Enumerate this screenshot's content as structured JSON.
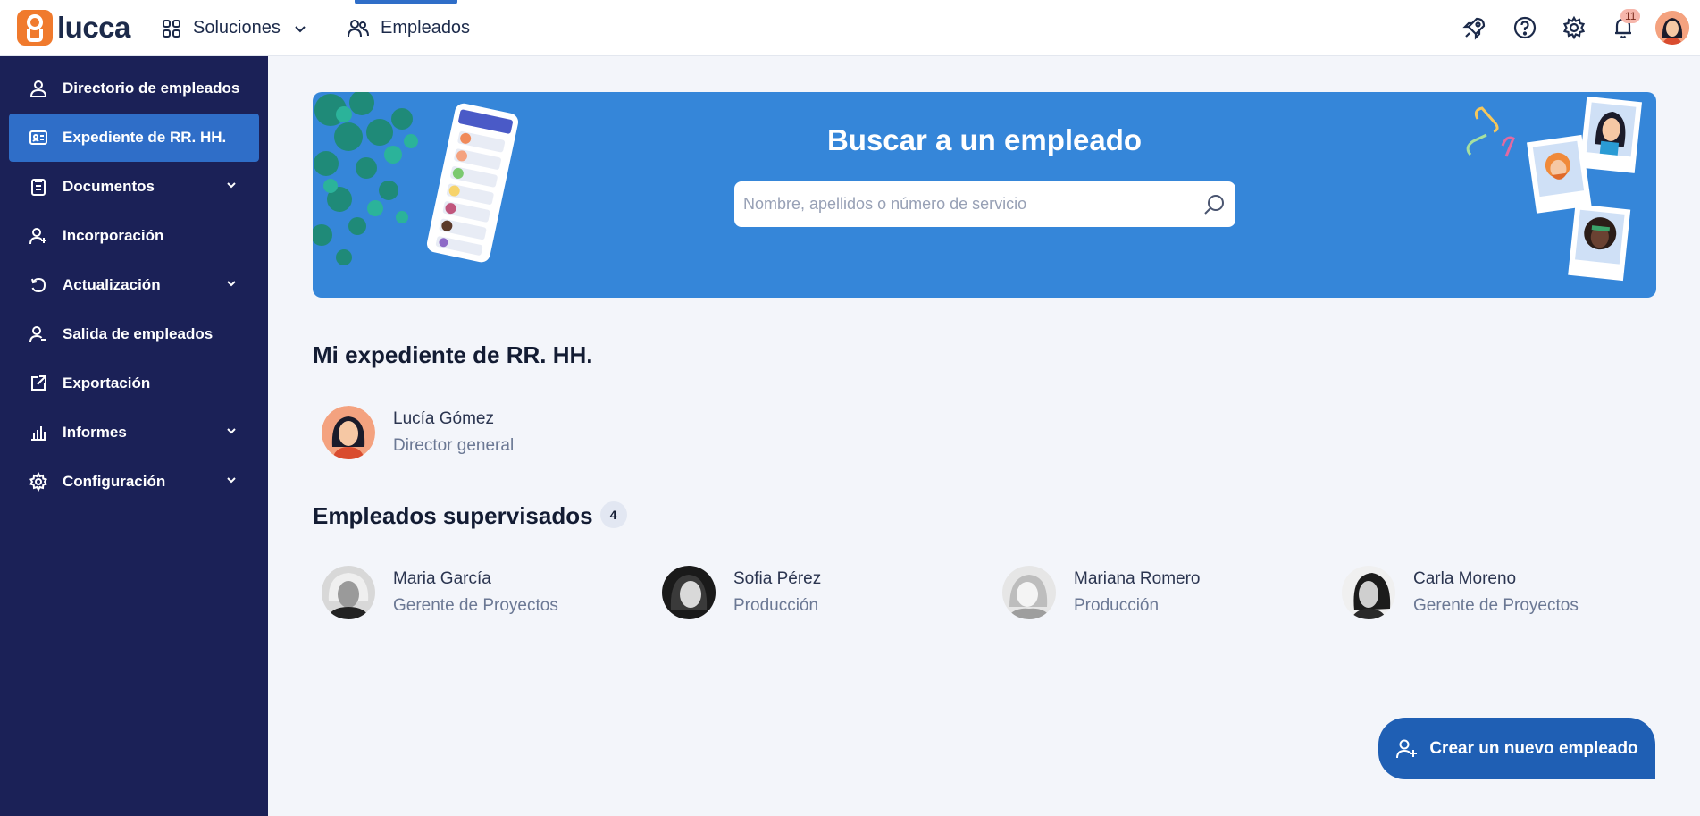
{
  "app": {
    "logo_text": "lucca",
    "nav": {
      "solutions_label": "Soluciones",
      "employees_label": "Empleados"
    },
    "notifications_count": "11",
    "icons": [
      "rocket-icon",
      "help-icon",
      "gear-icon",
      "bell-icon"
    ]
  },
  "sidebar": {
    "items": [
      {
        "label": "Directorio de empleados",
        "icon": "person-icon",
        "has_chevron": false,
        "active": false
      },
      {
        "label": "Expediente de RR. HH.",
        "icon": "id-card-icon",
        "has_chevron": false,
        "active": true
      },
      {
        "label": "Documentos",
        "icon": "clipboard-icon",
        "has_chevron": true,
        "active": false
      },
      {
        "label": "Incorporación",
        "icon": "person-add-icon",
        "has_chevron": false,
        "active": false
      },
      {
        "label": "Actualización",
        "icon": "refresh-icon",
        "has_chevron": true,
        "active": false
      },
      {
        "label": "Salida de empleados",
        "icon": "person-remove-icon",
        "has_chevron": false,
        "active": false
      },
      {
        "label": "Exportación",
        "icon": "external-link-icon",
        "has_chevron": false,
        "active": false
      },
      {
        "label": "Informes",
        "icon": "bar-chart-icon",
        "has_chevron": true,
        "active": false
      },
      {
        "label": "Configuración",
        "icon": "gear-icon",
        "has_chevron": true,
        "active": false
      }
    ]
  },
  "banner": {
    "title": "Buscar a un empleado",
    "search_placeholder": "Nombre, apellidos o número de servicio"
  },
  "my_file": {
    "title": "Mi expediente de RR. HH.",
    "person": {
      "name": "Lucía Gómez",
      "role": "Director general"
    }
  },
  "supervised": {
    "title": "Empleados supervisados",
    "count": "4",
    "people": [
      {
        "name": "Maria García",
        "role": "Gerente de Proyectos"
      },
      {
        "name": "Sofia Pérez",
        "role": "Producción"
      },
      {
        "name": "Mariana Romero",
        "role": "Producción"
      },
      {
        "name": "Carla Moreno",
        "role": "Gerente de Proyectos"
      }
    ]
  },
  "actions": {
    "create_employee_label": "Crear un nuevo empleado"
  },
  "colors": {
    "sidebar_bg": "#1b2157",
    "active_item": "#2f6ec8",
    "banner_bg": "#3586d9",
    "fab_bg": "#1f5fb4",
    "page_bg": "#f3f5fa"
  }
}
